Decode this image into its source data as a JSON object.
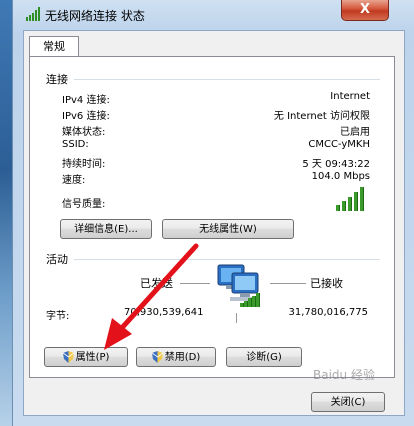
{
  "window": {
    "title": "无线网络连接 状态",
    "close_label": "X"
  },
  "tab": {
    "label": "常规"
  },
  "connection": {
    "section_title": "连接",
    "rows": [
      {
        "label": "IPv4 连接:",
        "value": "Internet"
      },
      {
        "label": "IPv6 连接:",
        "value": "无 Internet 访问权限"
      },
      {
        "label": "媒体状态:",
        "value": "已启用"
      },
      {
        "label": "SSID:",
        "value": "CMCC-yMKH"
      },
      {
        "label": "持续时间:",
        "value": "5 天 09:43:22"
      },
      {
        "label": "速度:",
        "value": "104.0 Mbps"
      }
    ],
    "signal_label": "信号质量:",
    "signal_level": "5/5",
    "details_button": "详细信息(E)...",
    "wireless_props_button": "无线属性(W)"
  },
  "activity": {
    "section_title": "活动",
    "sent_label": "已发送",
    "received_label": "已接收",
    "bytes_label": "字节:",
    "sent_value": "70,930,539,641",
    "received_value": "31,780,016,775"
  },
  "buttons": {
    "properties": "属性(P)",
    "disable": "禁用(D)",
    "diagnose": "诊断(G)",
    "close": "关闭(C)"
  },
  "watermark": "Baidu 经验"
}
